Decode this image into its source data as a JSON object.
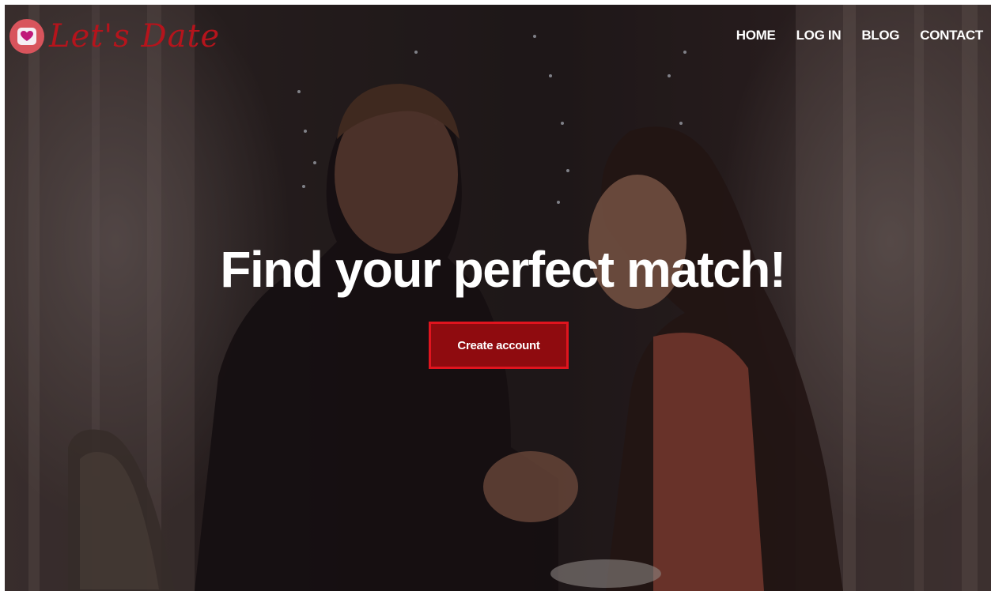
{
  "brand": {
    "name": "Let's Date",
    "logo_icon": "heart-icon",
    "color": "#b5141c"
  },
  "nav": {
    "items": [
      {
        "label": "HOME"
      },
      {
        "label": "LOG IN"
      },
      {
        "label": "BLOG"
      },
      {
        "label": "CONTACT"
      }
    ]
  },
  "hero": {
    "headline": "Find your perfect match!",
    "cta_label": "Create account",
    "cta_color": "#8f0b0f",
    "cta_border_color": "#e0141e"
  }
}
